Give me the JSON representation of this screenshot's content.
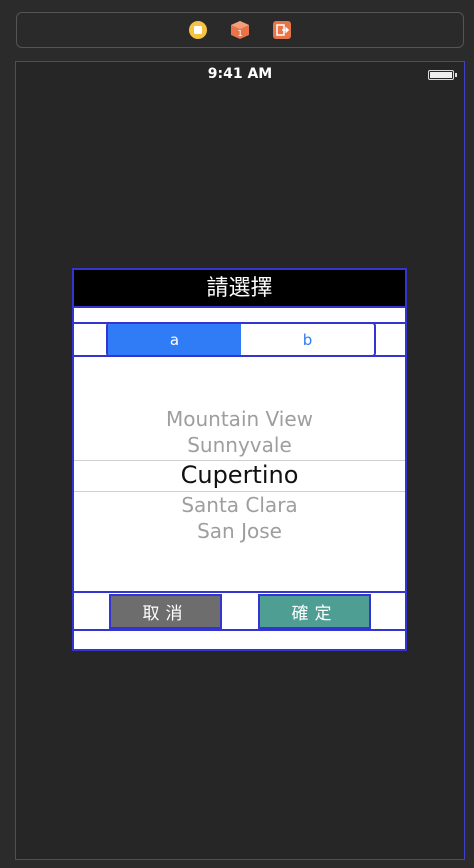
{
  "scene_dock": {
    "icons": [
      "view-controller-icon",
      "first-responder-icon",
      "exit-icon"
    ],
    "colors": {
      "view_controller": "#f5c242",
      "first_responder": "#e8744a",
      "exit": "#e8744a"
    }
  },
  "status_bar": {
    "time": "9:41 AM"
  },
  "dialog": {
    "title": "請選擇",
    "segments": [
      {
        "label": "a",
        "selected": true
      },
      {
        "label": "b",
        "selected": false
      }
    ],
    "picker": {
      "items": [
        "Mountain View",
        "Sunnyvale",
        "Cupertino",
        "Santa Clara",
        "San Jose"
      ],
      "selected": "Cupertino"
    },
    "cancel_label": "取消",
    "confirm_label": "確定"
  },
  "colors": {
    "background": "#2b2b2b",
    "outline": "#3434d0",
    "segment_accent": "#2f7cf6",
    "cancel": "#6d6d6d",
    "confirm": "#4e9e94"
  }
}
